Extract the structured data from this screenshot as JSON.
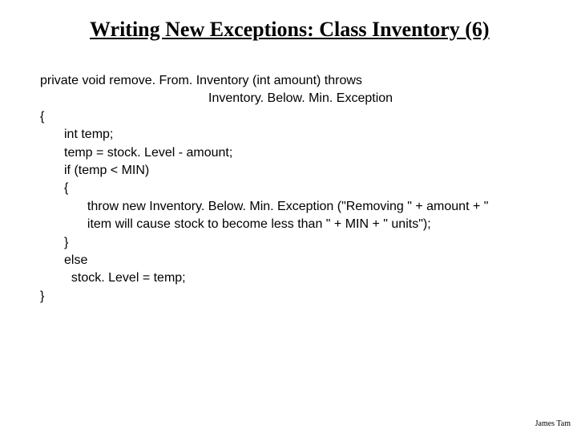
{
  "title": "Writing New Exceptions: Class Inventory (6)",
  "code": {
    "l1": "private void remove. From. Inventory (int amount) throws",
    "l2": "Inventory. Below. Min. Exception",
    "l3": "{",
    "l4": "int temp;",
    "l5": "temp = stock. Level - amount;",
    "l6": "if (temp < MIN)",
    "l7": "{",
    "l8": "  throw new Inventory. Below. Min. Exception (\"Removing \" + amount + \"",
    "l9": "  item will cause stock to become less than \" + MIN + \" units\");",
    "l10": "}",
    "l11": "else",
    "l12": "  stock. Level = temp;",
    "l13": "}"
  },
  "author": "James Tam"
}
